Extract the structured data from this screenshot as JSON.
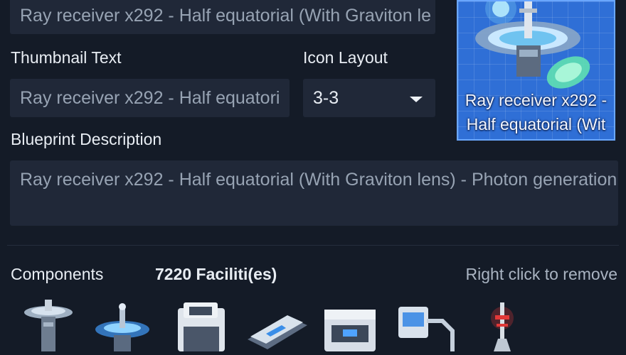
{
  "blueprint": {
    "name_value": "Ray receiver x292 - Half equatorial (With Graviton le",
    "thumbnail_text_label": "Thumbnail Text",
    "thumbnail_text_value": "Ray receiver x292 - Half equatori",
    "icon_layout_label": "Icon Layout",
    "icon_layout_value": "3-3",
    "description_label": "Blueprint Description",
    "description_value": "Ray receiver x292 - Half equatorial (With Graviton lens) - Photon generation",
    "thumbnail_caption_line1": "Ray receiver x292 -",
    "thumbnail_caption_line2": "Half equatorial (Wit"
  },
  "components": {
    "label": "Components",
    "count": "7220 Faciliti(es)",
    "hint": "Right click to remove",
    "items": [
      {
        "icon": "ray-receiver-icon"
      },
      {
        "icon": "planetary-logistics-icon"
      },
      {
        "icon": "assembler-icon"
      },
      {
        "icon": "conveyor-belt-icon"
      },
      {
        "icon": "storage-box-icon"
      },
      {
        "icon": "sorter-icon"
      },
      {
        "icon": "tesla-tower-icon"
      }
    ]
  },
  "colors": {
    "background": "#141b27",
    "field": "#202838",
    "thumbnail_bg": "#2f6fd6",
    "thumbnail_border": "#6aa7ff"
  }
}
